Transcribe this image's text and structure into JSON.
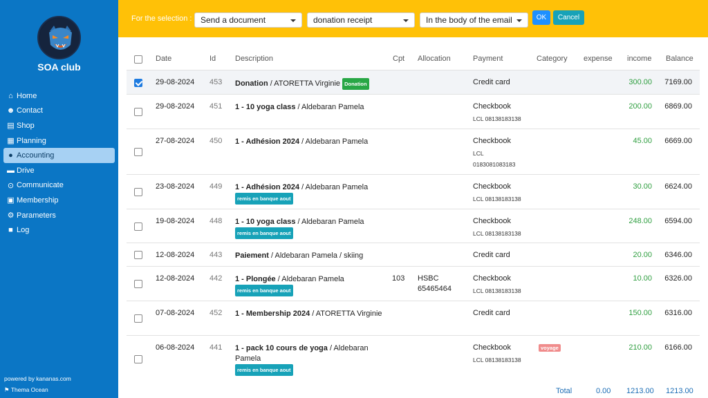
{
  "sidebar": {
    "club_name": "SOA club",
    "nav": [
      {
        "label": "Home",
        "icon": "home-icon",
        "glyph": "⌂"
      },
      {
        "label": "Contact",
        "icon": "users-icon",
        "glyph": "☻"
      },
      {
        "label": "Shop",
        "icon": "store-icon",
        "glyph": "▤"
      },
      {
        "label": "Planning",
        "icon": "calendar-icon",
        "glyph": "▦"
      },
      {
        "label": "Accounting",
        "icon": "piggy-bank-icon",
        "glyph": "●",
        "active": true
      },
      {
        "label": "Drive",
        "icon": "drive-icon",
        "glyph": "▬"
      },
      {
        "label": "Communicate",
        "icon": "broadcast-icon",
        "glyph": "⊙"
      },
      {
        "label": "Membership",
        "icon": "id-card-icon",
        "glyph": "▣"
      },
      {
        "label": "Parameters",
        "icon": "gear-icon",
        "glyph": "⚙"
      },
      {
        "label": "Log",
        "icon": "log-icon",
        "glyph": "■"
      }
    ],
    "powered": "powered by kananas.com",
    "theme": "Thema Ocean"
  },
  "toolbar": {
    "label": "For the selection :",
    "select1": "Send a document",
    "select2": "donation receipt",
    "select3": "In the body of the email",
    "ok": "OK",
    "cancel": "Cancel"
  },
  "table": {
    "headers": {
      "date": "Date",
      "id": "Id",
      "description": "Description",
      "cpt": "Cpt",
      "allocation": "Allocation",
      "payment": "Payment",
      "category": "Category",
      "expense": "expense",
      "income": "income",
      "balance": "Balance"
    },
    "rows": [
      {
        "checked": true,
        "date": "29-08-2024",
        "id": "453",
        "bold": "Donation",
        "rest": " / ATORETTA Virginie",
        "inline_badge": "Donation",
        "badge": "",
        "cpt": "",
        "alloc1": "",
        "alloc2": "",
        "payment": "Credit card",
        "pay_sub": "",
        "pay_sub2": "",
        "category": "",
        "income": "300.00",
        "balance": "7169.00"
      },
      {
        "checked": false,
        "date": "29-08-2024",
        "id": "451",
        "bold": "1 - 10 yoga class",
        "rest": " / Aldebaran Pamela",
        "inline_badge": "",
        "badge": "",
        "cpt": "",
        "alloc1": "",
        "alloc2": "",
        "payment": "Checkbook",
        "pay_sub": "LCL 08138183138",
        "pay_sub2": "",
        "category": "",
        "income": "200.00",
        "balance": "6869.00"
      },
      {
        "checked": false,
        "date": "27-08-2024",
        "id": "450",
        "bold": "1 - Adhésion 2024",
        "rest": " / Aldebaran Pamela",
        "inline_badge": "",
        "badge": "",
        "cpt": "",
        "alloc1": "",
        "alloc2": "",
        "payment": "Checkbook",
        "pay_sub": "LCL",
        "pay_sub2": "0183081083183",
        "category": "",
        "income": "45.00",
        "balance": "6669.00"
      },
      {
        "checked": false,
        "date": "23-08-2024",
        "id": "449",
        "bold": "1 - Adhésion 2024",
        "rest": " / Aldebaran Pamela",
        "inline_badge": "",
        "badge": "remis en banque aout",
        "cpt": "",
        "alloc1": "",
        "alloc2": "",
        "payment": "Checkbook",
        "pay_sub": "LCL 08138183138",
        "pay_sub2": "",
        "category": "",
        "income": "30.00",
        "balance": "6624.00"
      },
      {
        "checked": false,
        "date": "19-08-2024",
        "id": "448",
        "bold": "1 - 10 yoga class",
        "rest": " / Aldebaran Pamela",
        "inline_badge": "",
        "badge": "remis en banque aout",
        "cpt": "",
        "alloc1": "",
        "alloc2": "",
        "payment": "Checkbook",
        "pay_sub": "LCL 08138183138",
        "pay_sub2": "",
        "category": "",
        "income": "248.00",
        "balance": "6594.00"
      },
      {
        "checked": false,
        "date": "12-08-2024",
        "id": "443",
        "bold": "Paiement",
        "rest": " / Aldebaran Pamela / skiing",
        "inline_badge": "",
        "badge": "",
        "cpt": "",
        "alloc1": "",
        "alloc2": "",
        "payment": "Credit card",
        "pay_sub": "",
        "pay_sub2": "",
        "category": "",
        "income": "20.00",
        "balance": "6346.00"
      },
      {
        "checked": false,
        "date": "12-08-2024",
        "id": "442",
        "bold": "1 - Plongée",
        "rest": " / Aldebaran Pamela",
        "inline_badge": "",
        "badge": "remis en banque aout",
        "cpt": "103",
        "alloc1": "HSBC",
        "alloc2": "65465464",
        "payment": "Checkbook",
        "pay_sub": "LCL 08138183138",
        "pay_sub2": "",
        "category": "",
        "income": "10.00",
        "balance": "6326.00"
      },
      {
        "checked": false,
        "date": "07-08-2024",
        "id": "452",
        "bold": "1 - Membership 2024",
        "rest": " / ATORETTA Virginie",
        "inline_badge": "",
        "badge": "",
        "cpt": "",
        "alloc1": "",
        "alloc2": "",
        "payment": "Credit card",
        "pay_sub": "",
        "pay_sub2": "",
        "category": "",
        "income": "150.00",
        "balance": "6316.00"
      },
      {
        "checked": false,
        "date": "06-08-2024",
        "id": "441",
        "bold": "1 - pack 10 cours de yoga",
        "rest": " / Aldebaran Pamela",
        "inline_badge": "",
        "badge": "remis en banque aout",
        "cpt": "",
        "alloc1": "",
        "alloc2": "",
        "payment": "Checkbook",
        "pay_sub": "LCL 08138183138",
        "pay_sub2": "",
        "category": "voyage",
        "income": "210.00",
        "balance": "6166.00"
      }
    ],
    "totals": {
      "label": "Total",
      "expense": "0.00",
      "income": "1213.00",
      "balance": "1213.00"
    }
  },
  "colors": {
    "sidebar": "#0b76c5",
    "toolbar": "#ffc107",
    "income": "#2e9e3f",
    "ok": "#1e90ff",
    "cancel": "#17a2b8"
  }
}
